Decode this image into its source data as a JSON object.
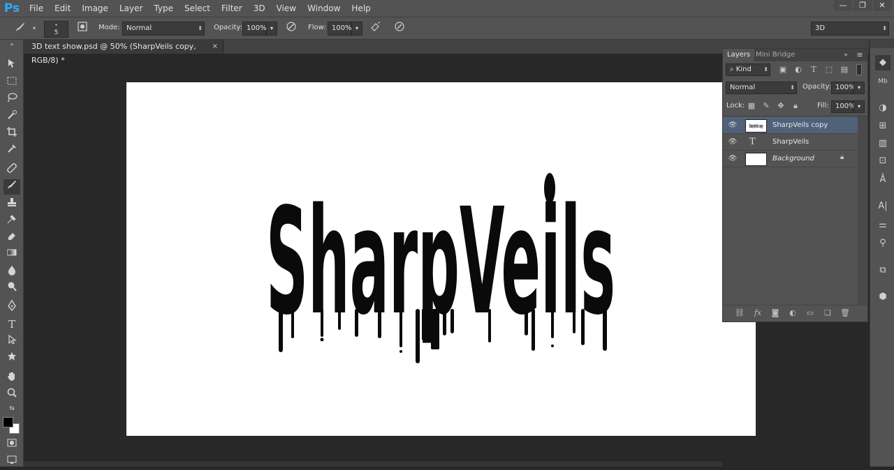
{
  "app": {
    "logo": "Ps"
  },
  "menu": [
    "File",
    "Edit",
    "Image",
    "Layer",
    "Type",
    "Select",
    "Filter",
    "3D",
    "View",
    "Window",
    "Help"
  ],
  "window_controls": {
    "minimize": "—",
    "restore": "❐",
    "close": "✕"
  },
  "options_bar": {
    "brush_size": "5",
    "mode_label": "Mode:",
    "mode_value": "Normal",
    "opacity_label": "Opacity:",
    "opacity_value": "100%",
    "flow_label": "Flow:",
    "flow_value": "100%",
    "workspace": "3D"
  },
  "document": {
    "tab_title": "3D text show.psd @ 50% (SharpVeils copy, RGB/8) *",
    "tab_close": "×",
    "artwork_text": "SharpVeils"
  },
  "layers_panel": {
    "tabs": [
      "Layers",
      "Mini Bridge"
    ],
    "filter_kind": "Kind",
    "blend_mode": "Normal",
    "opacity_label": "Opacity:",
    "opacity_value": "100%",
    "lock_label": "Lock:",
    "fill_label": "Fill:",
    "fill_value": "100%",
    "layers": [
      {
        "name": "SharpVeils copy",
        "selected": true,
        "kind": "raster"
      },
      {
        "name": "SharpVeils",
        "selected": false,
        "kind": "text"
      },
      {
        "name": "Background",
        "selected": false,
        "kind": "background",
        "locked": true
      }
    ]
  },
  "colors": {
    "chrome": "#535353",
    "workspace": "#282828",
    "selection": "#50627a",
    "logo": "#31a8ff",
    "foreground_swatch": "#000000",
    "background_swatch": "#ffffff"
  }
}
